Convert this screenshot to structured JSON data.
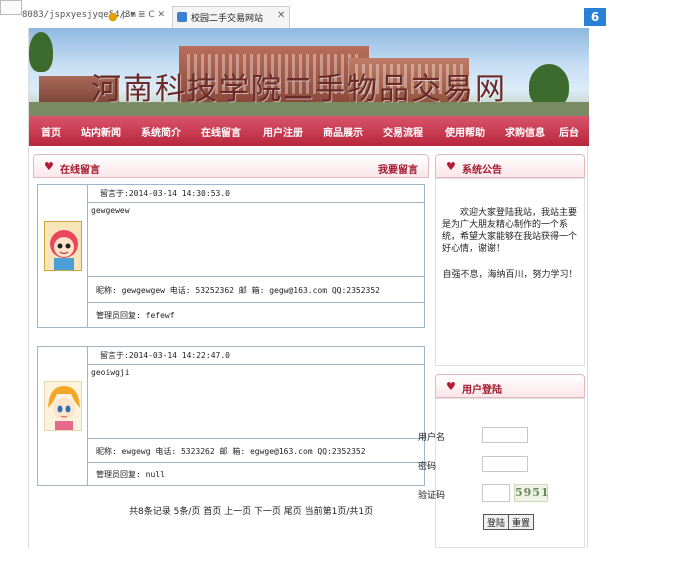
{
  "browser": {
    "address_text": "8083/jspxyesjyqe54/3m",
    "address_icons": "ρ ▾ ≣ C ✕",
    "tab_title": "校园二手交易网站",
    "tab_close": "✕",
    "corner_button": "6"
  },
  "site": {
    "banner_title": "河南科技学院二手物品交易网",
    "nav": [
      "首页",
      "站内新闻",
      "系统简介",
      "在线留言",
      "用户注册",
      "商品展示",
      "交易流程",
      "使用帮助",
      "求购信息",
      "后台"
    ]
  },
  "guestbook": {
    "title": "在线留言",
    "post_link": "我要留言",
    "messages": [
      {
        "time": "留言于:2014-03-14 14:30:53.0",
        "content": "gewgewew",
        "info": "昵称: gewgewgew  电话: 53252362  邮 箱: gegw@163.com  QQ:2352352",
        "reply": "管理员回复: fefewf"
      },
      {
        "time": "留言于:2014-03-14 14:22:47.0",
        "content": "geoiwgji",
        "info": "昵称: ewgewg  电话: 5323262  邮 箱: egwge@163.com  QQ:2352352",
        "reply": "管理员回复: null"
      }
    ],
    "pager": "共8条记录  5条/页  首页  上一页  下一页  尾页  当前第1页/共1页"
  },
  "notice": {
    "title": "系统公告",
    "text": "欢迎大家登陆我站，我站主要是为广大朋友精心制作的一个系统，希望大家能够在我站获得一个好心情，谢谢！",
    "motto": "自强不息，海纳百川，努力学习！"
  },
  "login": {
    "title": "用户登陆",
    "username_label": "用户名",
    "password_label": "密码",
    "captcha_label": "验证码",
    "captcha_text": "5951",
    "login_button": "登陆",
    "reset_button": "重置"
  },
  "colors": {
    "nav": "#c23a50",
    "accent": "#b31b34",
    "table_border": "#9cb6cc"
  }
}
